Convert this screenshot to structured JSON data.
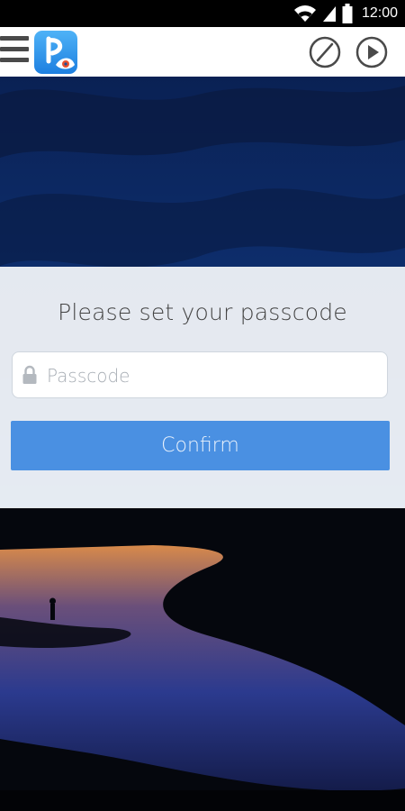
{
  "status_bar": {
    "time": "12:00",
    "icons": [
      "wifi-icon",
      "signal-icon",
      "battery-icon"
    ]
  },
  "toolbar": {
    "menu_icon": "menu-icon",
    "app_logo": "app-logo",
    "actions": [
      "edit-icon",
      "play-icon"
    ]
  },
  "passcode": {
    "title": "Please set your passcode",
    "field_placeholder": "Passcode",
    "field_value": "",
    "field_icon": "lock-icon",
    "confirm_label": "Confirm"
  },
  "colors": {
    "accent": "#4a90e2",
    "toolbar_bg": "#ffffff",
    "panel_bg": "#f5f7fa",
    "sky": "#0c2a63",
    "water": "#2c3a8a"
  }
}
